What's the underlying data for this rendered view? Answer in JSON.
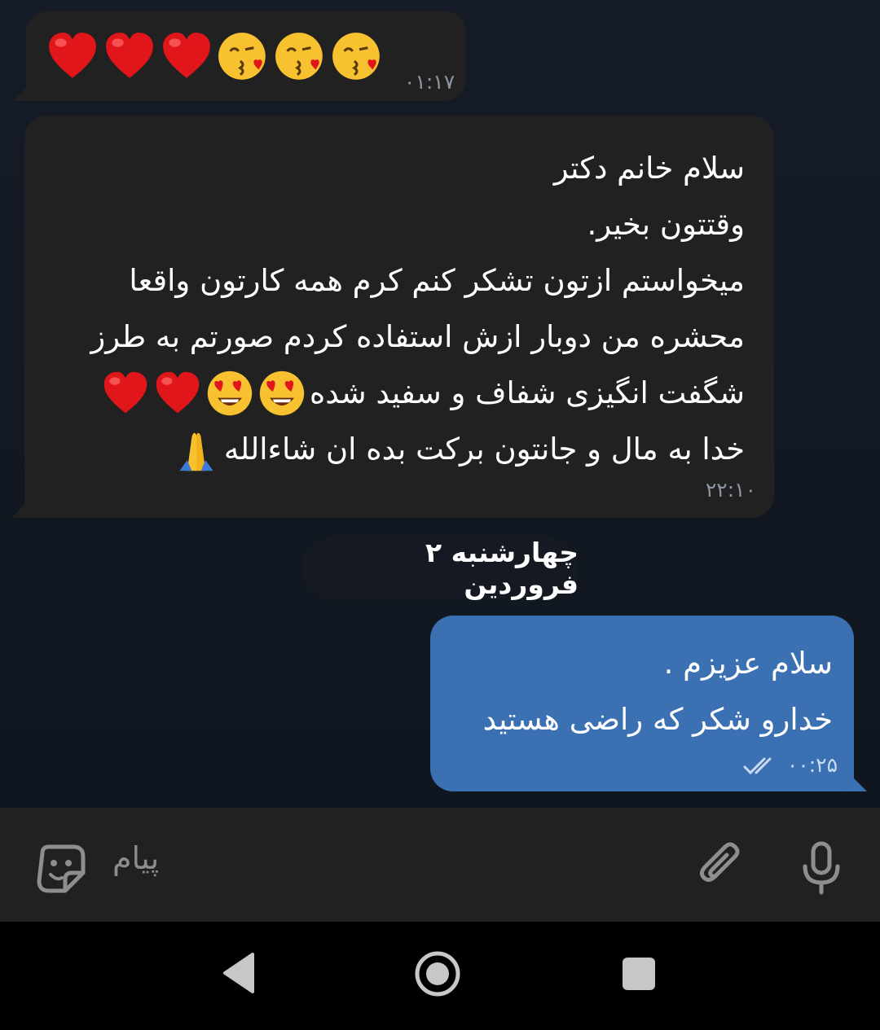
{
  "messages": [
    {
      "id": "m1",
      "direction": "incoming",
      "emojis": [
        "red-heart",
        "red-heart",
        "red-heart",
        "face-blowing-a-kiss",
        "face-blowing-a-kiss",
        "face-blowing-a-kiss"
      ],
      "time": "۰۱:۱۷"
    },
    {
      "id": "m2",
      "direction": "incoming",
      "lines": [
        "سلام خانم دکتر",
        "وقتتون بخیر.",
        "میخواستم ازتون تشکر کنم کرم همه کارتون واقعا",
        "محشره من دوبار ازش استفاده کردم صورتم به طرز",
        "شگفت انگیزی شفاف و سفید شده",
        "خدا به مال و جانتون برکت بده ان شاءالله"
      ],
      "line5_emojis": [
        "smiling-face-with-heart-eyes",
        "smiling-face-with-heart-eyes",
        "red-heart",
        "red-heart"
      ],
      "line6_emojis": [
        "folded-hands"
      ],
      "time": "۲۲:۱۰"
    },
    {
      "id": "m3",
      "direction": "outgoing",
      "lines": [
        "سلام عزیزم .",
        "خدارو شکر که راضی هستید"
      ],
      "time": "۰۰:۲۵",
      "status": "read"
    }
  ],
  "date_separator": "چهارشنبه ۲ فروردین",
  "composer": {
    "placeholder": "پیام",
    "icons": [
      "sticker-icon",
      "attach-icon",
      "microphone-icon"
    ]
  },
  "navbar": {
    "icons": [
      "back-icon",
      "home-icon",
      "recents-icon"
    ]
  },
  "colors": {
    "chat_bg": "#121923",
    "incoming_bubble": "#212121",
    "outgoing_bubble": "#3b70b3",
    "composer_bg": "#212121",
    "navbar_bg": "#000000"
  }
}
